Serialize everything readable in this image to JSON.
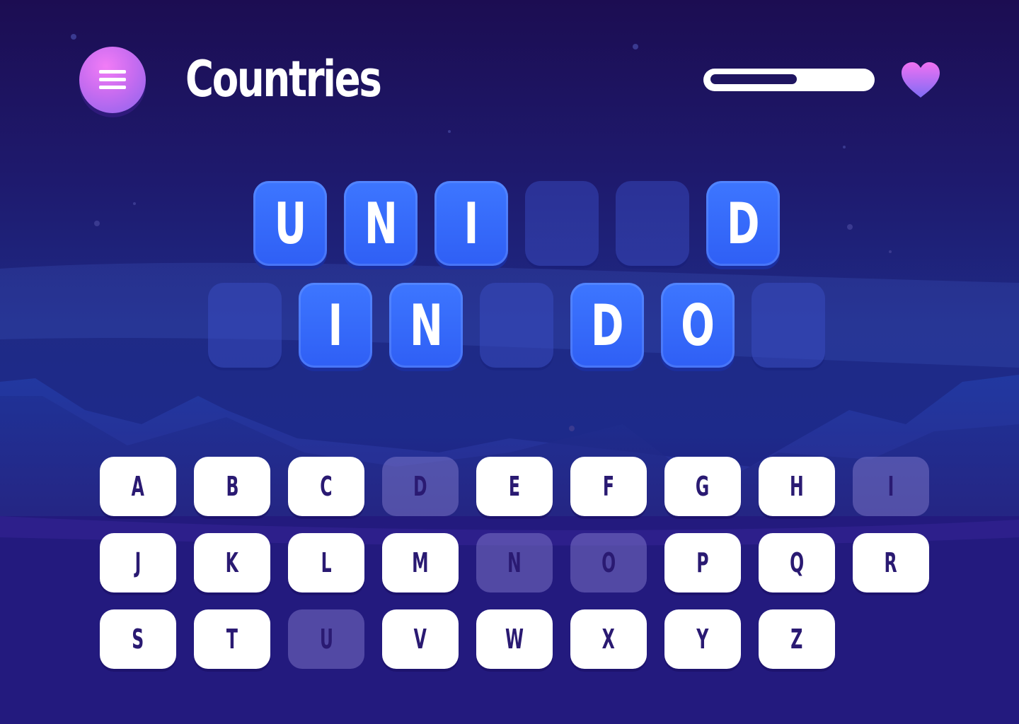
{
  "header": {
    "menu_label": "menu",
    "title": "Countries",
    "progress": 0.55,
    "lives_icon": "heart-icon"
  },
  "puzzle": {
    "row1": [
      "U",
      "N",
      "I",
      "",
      "",
      "D"
    ],
    "row2": [
      "",
      "I",
      "N",
      "",
      "D",
      "O",
      ""
    ]
  },
  "keyboard": {
    "rows": [
      [
        {
          "letter": "A",
          "used": false
        },
        {
          "letter": "B",
          "used": false
        },
        {
          "letter": "C",
          "used": false
        },
        {
          "letter": "D",
          "used": true
        },
        {
          "letter": "E",
          "used": false
        },
        {
          "letter": "F",
          "used": false
        },
        {
          "letter": "G",
          "used": false
        },
        {
          "letter": "H",
          "used": false
        },
        {
          "letter": "I",
          "used": true
        }
      ],
      [
        {
          "letter": "J",
          "used": false
        },
        {
          "letter": "K",
          "used": false
        },
        {
          "letter": "L",
          "used": false
        },
        {
          "letter": "M",
          "used": false
        },
        {
          "letter": "N",
          "used": true
        },
        {
          "letter": "O",
          "used": true
        },
        {
          "letter": "P",
          "used": false
        },
        {
          "letter": "Q",
          "used": false
        },
        {
          "letter": "R",
          "used": false
        }
      ],
      [
        {
          "letter": "S",
          "used": false
        },
        {
          "letter": "T",
          "used": false
        },
        {
          "letter": "U",
          "used": true
        },
        {
          "letter": "V",
          "used": false
        },
        {
          "letter": "W",
          "used": false
        },
        {
          "letter": "X",
          "used": false
        },
        {
          "letter": "Y",
          "used": false
        },
        {
          "letter": "Z",
          "used": false
        }
      ]
    ]
  },
  "colors": {
    "tile_filled": "#2f5ff5",
    "key_active": "#ffffff",
    "key_used": "#5a4ea8",
    "accent": "#c86cf0"
  }
}
